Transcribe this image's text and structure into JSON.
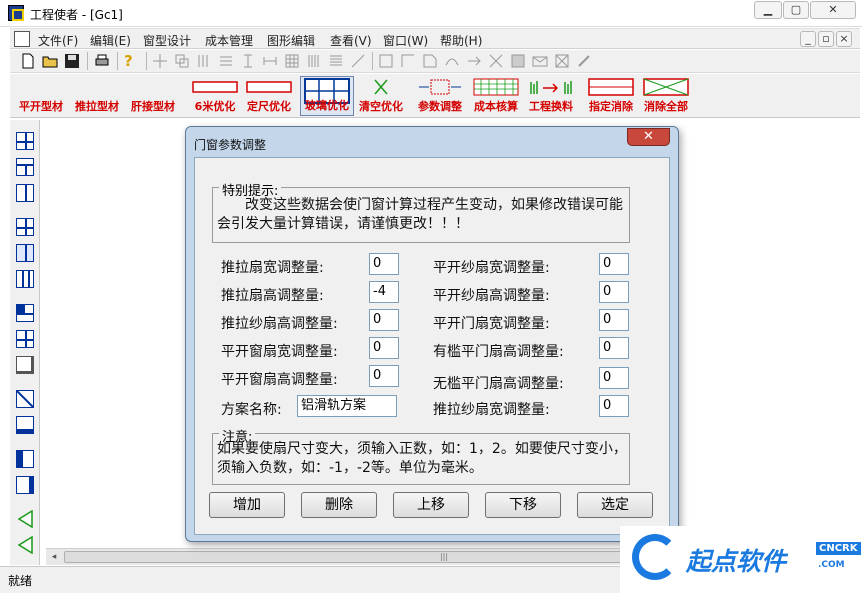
{
  "window": {
    "title": "工程使者 - [Gc1]"
  },
  "menu": [
    "文件(F)",
    "编辑(E)",
    "窗型设计",
    "成本管理",
    "图形编辑",
    "查看(V)",
    "窗口(W)",
    "帮助(H)"
  ],
  "toolbar2": {
    "buttons": [
      "平开型材",
      "推拉型材",
      "肝接型材",
      "6米优化",
      "定尺优化",
      "玻璃优化",
      "清空优化",
      "参数调整",
      "成本核算",
      "工程换料",
      "指定消除",
      "消除全部"
    ]
  },
  "dialog": {
    "title": "门窗参数调整",
    "close_glyph": "✕",
    "notice": {
      "title": "特别提示:",
      "text": "　　改变这些数据会使门窗计算过程产生变动，如果修改错误可能会引发大量计算错误，请谨慎更改！！！"
    },
    "fields_left": [
      {
        "label": "推拉扇宽调整量:",
        "value": "0"
      },
      {
        "label": "推拉扇高调整量:",
        "value": "-4"
      },
      {
        "label": "推拉纱扇高调整量:",
        "value": "0"
      },
      {
        "label": "平开窗扇宽调整量:",
        "value": "0"
      },
      {
        "label": "平开窗扇高调整量:",
        "value": "0"
      }
    ],
    "fields_right": [
      {
        "label": "平开纱扇宽调整量:",
        "value": "0"
      },
      {
        "label": "平开纱扇高调整量:",
        "value": "0"
      },
      {
        "label": "平开门扇宽调整量:",
        "value": "0"
      },
      {
        "label": "有槛平门扇高调整量:",
        "value": "0"
      },
      {
        "label": "无槛平门扇高调整量:",
        "value": "0"
      },
      {
        "label": "推拉纱扇宽调整量:",
        "value": "0"
      }
    ],
    "scheme": {
      "label": "方案名称:",
      "value": "铝滑轨方案"
    },
    "note": {
      "title": "注意:",
      "text": "如果要使扇尺寸变大，须输入正数，如：1，2。如要使尺寸变小，须输入负数，如：-1，-2等。单位为毫米。"
    },
    "buttons": {
      "add": "增加",
      "delete": "删除",
      "up": "上移",
      "down": "下移",
      "select": "选定"
    }
  },
  "statusbar": {
    "text": "就绪"
  },
  "watermark": {
    "main": "起点软件",
    "badge": "CNCRK",
    "sub": ".COM"
  },
  "colors": {
    "accent_red": "#d40000",
    "side_blue": "#00329b",
    "dialog_frame": "#c3d6ea",
    "close_red": "#c9483c",
    "watermark_blue": "#1b7ae0"
  }
}
